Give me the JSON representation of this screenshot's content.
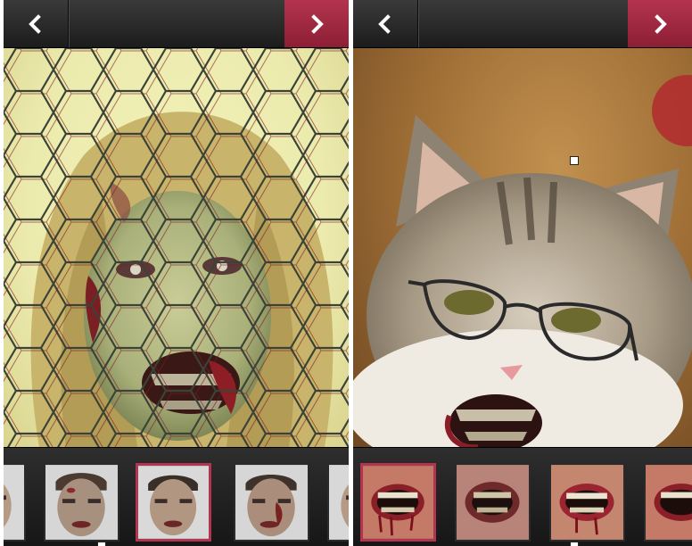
{
  "left_screen": {
    "nav": {
      "back_icon": "chevron-left-icon",
      "next_icon": "chevron-right-icon"
    },
    "photo": {
      "subject": "zombie-face-photo",
      "overlay": "chicken-wire-fence"
    },
    "thumbnails": [
      "zombie-face",
      "zombie-face",
      "zombie-face",
      "zombie-face",
      "zombie-face"
    ],
    "selected_thumbnail": 2
  },
  "right_screen": {
    "nav": {
      "back_icon": "chevron-left-icon",
      "next_icon": "chevron-right-icon"
    },
    "photo": {
      "subject": "cat-with-glasses-and-zombie-mouth"
    },
    "thumbnails": [
      "zombie-mouth",
      "zombie-mouth",
      "zombie-mouth",
      "zombie-mouth"
    ],
    "selected_thumbnail": 0
  },
  "colors": {
    "accent": "#a5283f",
    "bar": "#262626",
    "selection": "#b23450"
  }
}
